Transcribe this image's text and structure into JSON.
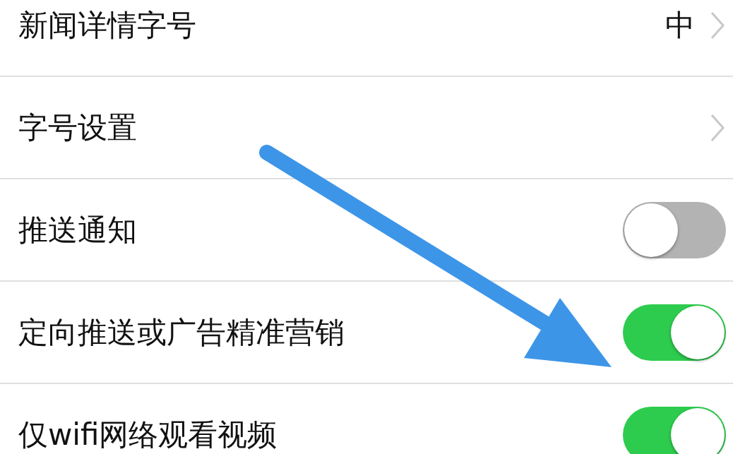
{
  "settings": [
    {
      "kind": "value",
      "label": "新闻详情字号",
      "value": "中"
    },
    {
      "kind": "link",
      "label": "字号设置"
    },
    {
      "kind": "toggle",
      "label": "推送通知",
      "on": false
    },
    {
      "kind": "toggle",
      "label": "定向推送或广告精准营销",
      "on": true
    },
    {
      "kind": "toggle",
      "label": "仅wifi网络观看视频",
      "on": true
    }
  ]
}
